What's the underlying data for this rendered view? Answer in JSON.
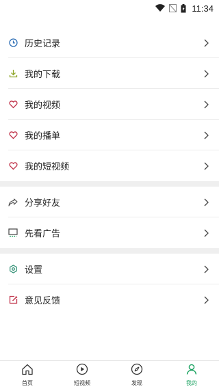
{
  "status_bar": {
    "time": "11:34"
  },
  "groups": [
    [
      {
        "label": "历史记录",
        "icon": "history-icon"
      },
      {
        "label": "我的下载",
        "icon": "download-icon"
      },
      {
        "label": "我的视频",
        "icon": "heart-icon"
      },
      {
        "label": "我的播单",
        "icon": "heart-icon"
      },
      {
        "label": "我的短视频",
        "icon": "heart-icon"
      }
    ],
    [
      {
        "label": "分享好友",
        "icon": "share-icon"
      },
      {
        "label": "先看广告",
        "icon": "monitor-icon"
      }
    ],
    [
      {
        "label": "设置",
        "icon": "settings-icon"
      },
      {
        "label": "意见反馈",
        "icon": "feedback-icon"
      }
    ]
  ],
  "bottom_nav": [
    {
      "label": "首页",
      "icon": "home-icon",
      "active": false
    },
    {
      "label": "短视频",
      "icon": "play-circle-icon",
      "active": false
    },
    {
      "label": "发现",
      "icon": "compass-icon",
      "active": false
    },
    {
      "label": "我的",
      "icon": "user-icon",
      "active": true
    }
  ],
  "colors": {
    "accent": "#1aa260",
    "heart": "#c0334a",
    "download": "#8fa62a",
    "history": "#2f6fb5",
    "settings": "#2f8f74",
    "feedback": "#c0334a"
  }
}
